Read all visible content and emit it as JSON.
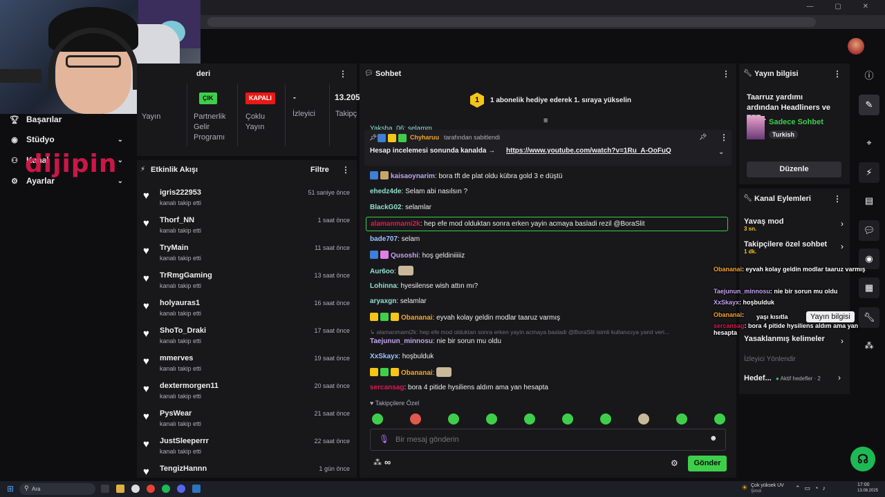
{
  "leftnav": {
    "items": [
      {
        "label": "Başarılar",
        "icon": "trophy-icon"
      },
      {
        "label": "Stüdyo",
        "icon": "studio-icon"
      },
      {
        "label": "Kanal",
        "icon": "channel-icon"
      },
      {
        "label": "Ayarlar",
        "icon": "gear-icon"
      }
    ],
    "watermark": "dijipin"
  },
  "stats": {
    "title": "deri",
    "badges": [
      {
        "label": "ÇIK",
        "color": "#3ecf4a"
      },
      {
        "label": "KAPALI",
        "color": "#e91916"
      }
    ],
    "labels": [
      "Yayın",
      "Partnerlik\nGelir\nProgramı",
      "Çoklu\nYayın",
      "İzleyici",
      "Takipç"
    ],
    "viewers": "-",
    "followers": "13.205"
  },
  "activity": {
    "title": "Etkinlik Akışı",
    "filter": "Filtre",
    "items": [
      {
        "name": "igris222953",
        "sub": "kanalı takip etti",
        "time": "51 saniye önce"
      },
      {
        "name": "Thorf_NN",
        "sub": "kanalı takip etti",
        "time": "1 saat önce"
      },
      {
        "name": "TryMain",
        "sub": "kanalı takip etti",
        "time": "11 saat önce"
      },
      {
        "name": "TrRmgGaming",
        "sub": "kanalı takip etti",
        "time": "13 saat önce"
      },
      {
        "name": "holyauras1",
        "sub": "kanalı takip etti",
        "time": "16 saat önce"
      },
      {
        "name": "ShoTo_Draki",
        "sub": "kanalı takip etti",
        "time": "17 saat önce"
      },
      {
        "name": "mmerves",
        "sub": "kanalı takip etti",
        "time": "19 saat önce"
      },
      {
        "name": "dextermorgen11",
        "sub": "kanalı takip etti",
        "time": "20 saat önce"
      },
      {
        "name": "PysWear",
        "sub": "kanalı takip etti",
        "time": "21 saat önce"
      },
      {
        "name": "JustSleeperrr",
        "sub": "kanalı takip etti",
        "time": "22 saat önce"
      },
      {
        "name": "TengizHannn",
        "sub": "",
        "time": "1 gün önce"
      }
    ]
  },
  "chat": {
    "title": "Sohbet",
    "gift_rank": "1",
    "gift_banner": "1 abonelik hediye ederek 1. sıraya yükselin",
    "partial_top": "Yaksha_06: selamm",
    "pinned": {
      "by": "Chyharuu",
      "by_suffix": "tarafından sabitlendi",
      "text": "Hesap incelemesi sonunda kanalda →",
      "link": "https://www.youtube.com/watch?v=1Ru_A-OoFuQ"
    },
    "messages": [
      {
        "user": "kaisaoynarim",
        "color": "#c4a4f0",
        "text": ": bora tft de plat oldu kübra gold 3 e düştü"
      },
      {
        "user": "ehedz4de",
        "color": "#8fe0c8",
        "text": ": Selam abi nasılsın ?"
      },
      {
        "user": "BlackG02",
        "color": "#8fe0c8",
        "text": ": selamlar"
      },
      {
        "user": "alamanmami2k",
        "color": "#e0194f",
        "text": ": hep efe mod olduktan sonra erken yayin acmaya basladi rezil @BoraSlit"
      },
      {
        "user": "bade707",
        "color": "#9ac4ff",
        "text": ": selam"
      },
      {
        "user": "Qusoshi",
        "color": "#c4a4f0",
        "text": ": hoş geldiniiiiiz"
      },
      {
        "user": "Aur6oo",
        "color": "#8fe0c8",
        "text": ":"
      },
      {
        "user": "Lohinna",
        "color": "#8fe0c8",
        "text": ": hyesilense wish attın mı?"
      },
      {
        "user": "aryaxgn",
        "color": "#8fe0c8",
        "text": ": selamlar"
      },
      {
        "user": "Obananai",
        "color": "#f5a623",
        "text": ": eyvah kolay geldin modlar taaruz varmış"
      },
      {
        "user": "Taejunun_minnosu",
        "color": "#c4a4f0",
        "text": ": nie bir sorun mu oldu"
      },
      {
        "user": "XxSkayx",
        "color": "#9ac4ff",
        "text": ": hoşbulduk"
      },
      {
        "user": "Obananai",
        "color": "#f5a623",
        "text": ":"
      },
      {
        "user": "sercansag",
        "color": "#e0194f",
        "text": ": bora 4 pitide hysiliens aldım ama yan hesapta"
      }
    ],
    "reply_ref": "alamanmami2k: hep efe mod olduktan sonra erken yayin acmaya basladi @BoraSlit isimli kullanıcıya yanıt veri...",
    "followers_only": "Takipçilere Özel",
    "input_placeholder": "Bir mesaj gönderin",
    "send": "Gönder",
    "points": "∞"
  },
  "yayin": {
    "title": "Yayın bilgisi",
    "stream_title": "Taarruz yardımı ardından Headliners ve TFT...",
    "category": "Sadece Sohbet",
    "tag": "Turkish",
    "edit": "Düzenle"
  },
  "kanal": {
    "title": "Kanal Eylemleri",
    "actions": [
      {
        "t": "Yavaş mod",
        "s": "3 sn."
      },
      {
        "t": "Takipçilere özel sohbet",
        "s": "1 dk."
      },
      {
        "t": "Yasaklanmış kelimeler",
        "s": ""
      }
    ],
    "viewer_redirect": "İzleyici Yönlendir",
    "goals": "Hedef...",
    "goals_active": "Aktif hedefler · 2"
  },
  "overlay": [
    {
      "user": "Obananai",
      "text": ": eyvah kolay geldin modlar taaruz varmış"
    },
    {
      "user": "Taejunun_minnosu",
      "text": ": nie bir sorun mu oldu"
    },
    {
      "user": "XxSkayx",
      "text": ": hoşbulduk"
    },
    {
      "user": "Obananai",
      "text": ":"
    },
    {
      "user": "sercansag",
      "text": ": bora 4 pitide hysiliens aldım ama yan hesapta"
    }
  ],
  "overlay_partial": "yaşı kısıtla",
  "tooltip": "Yayın bilgisi",
  "taskbar": {
    "search": "Ara",
    "weather": "Çok yüksek UV",
    "weather_sub": "Şimdi",
    "time": "17:00",
    "date": "13.08.2025"
  }
}
